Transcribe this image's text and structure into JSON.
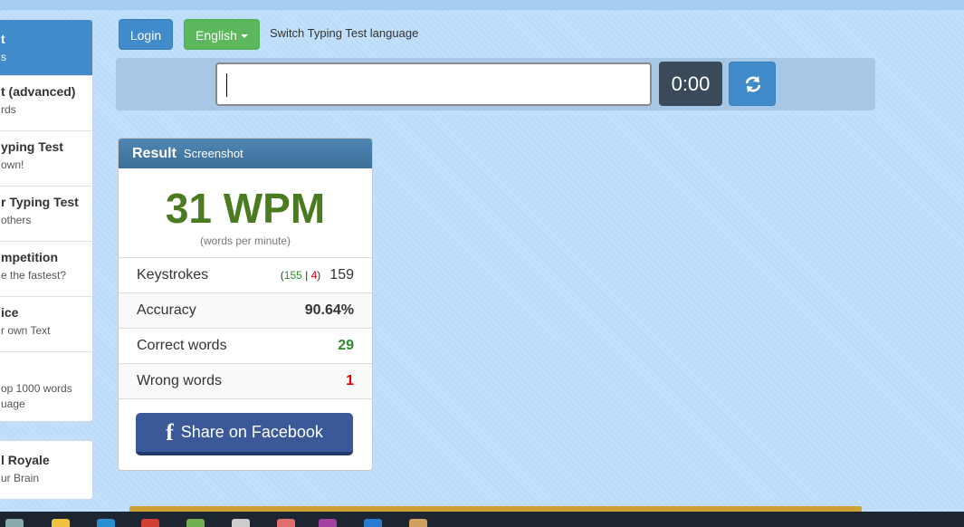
{
  "sidebar": {
    "items": [
      {
        "title": "t",
        "subtitle": "s"
      },
      {
        "title": "t (advanced)",
        "subtitle": "rds"
      },
      {
        "title": "yping Test",
        "subtitle": "own!"
      },
      {
        "title": "r Typing Test",
        "subtitle": "others"
      },
      {
        "title": "mpetition",
        "subtitle": "e the fastest?"
      },
      {
        "title": "ice",
        "subtitle": "r own Text"
      },
      {
        "title": "",
        "subtitle": "op 1000 words",
        "subtitle2": "uage"
      }
    ],
    "extra_item": {
      "title": "l Royale",
      "subtitle": "ur Brain"
    }
  },
  "header": {
    "login_label": "Login",
    "language_label": "English",
    "language_hint": "Switch Typing Test language"
  },
  "typing": {
    "input_value": "",
    "timer": "0:00"
  },
  "result": {
    "title": "Result",
    "screenshot_label": "Screenshot",
    "wpm": "31 WPM",
    "wpm_caption": "(words per minute)",
    "rows": {
      "keystrokes": {
        "label": "Keystrokes",
        "correct": "155",
        "separator": "|",
        "wrong": "4",
        "open": "(",
        "close": ")",
        "total": "159"
      },
      "accuracy": {
        "label": "Accuracy",
        "value": "90.64%"
      },
      "correct_words": {
        "label": "Correct words",
        "value": "29"
      },
      "wrong_words": {
        "label": "Wrong words",
        "value": "1"
      }
    },
    "share_label": "Share on Facebook"
  },
  "colors": {
    "primary": "#428bca",
    "success": "#5cb85c",
    "facebook": "#3b5998",
    "wpm_green": "#4a7b20"
  }
}
